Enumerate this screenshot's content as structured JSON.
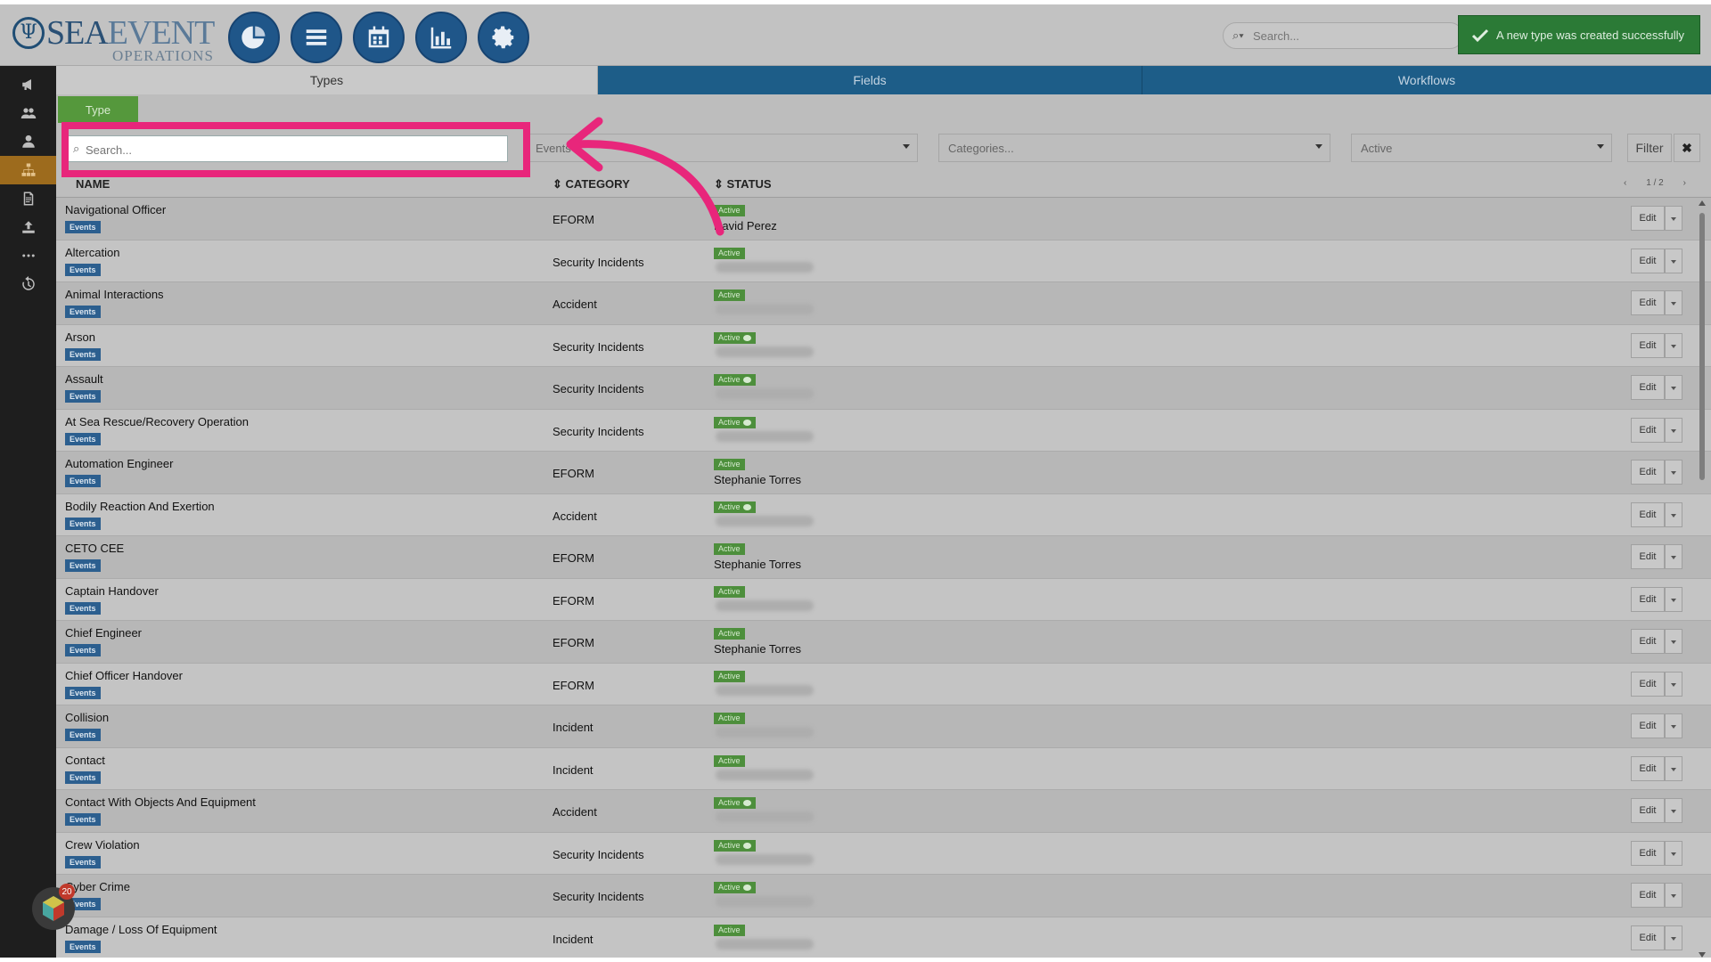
{
  "header": {
    "logo": {
      "brand_a": "SEA",
      "brand_b": "EVENT",
      "subtitle": "OPERATIONS"
    },
    "nav_icons": [
      "dashboard-icon",
      "list-icon",
      "calendar-icon",
      "bar-chart-icon",
      "gear-icon"
    ],
    "search_placeholder": "Search...",
    "toast": "A new type was created successfully"
  },
  "sidebar": {
    "items": [
      "megaphone-icon",
      "users-icon",
      "user-icon",
      "sitemap-icon",
      "document-icon",
      "upload-icon",
      "more-icon",
      "history-icon"
    ],
    "active_index": 3
  },
  "tabs": [
    "Types",
    "Fields",
    "Workflows"
  ],
  "subtab": "Type",
  "filters": {
    "search_placeholder": "Search...",
    "module_value": "Events",
    "categories_placeholder": "Categories...",
    "status_value": "Active",
    "filter_label": "Filter",
    "clear_label": "✖"
  },
  "table": {
    "columns": [
      "NAME",
      "CATEGORY",
      "STATUS"
    ],
    "pager": {
      "prev": "‹",
      "page": "1 / 2",
      "next": "›"
    },
    "badge_label": "Events",
    "status_label": "Active",
    "edit_label": "Edit",
    "rows": [
      {
        "name": "Navigational Officer",
        "category": "EFORM",
        "owner": "David Perez",
        "bubble": false
      },
      {
        "name": "Altercation",
        "category": "Security Incidents",
        "owner": "",
        "bubble": false
      },
      {
        "name": "Animal Interactions",
        "category": "Accident",
        "owner": "",
        "bubble": false
      },
      {
        "name": "Arson",
        "category": "Security Incidents",
        "owner": "",
        "bubble": true
      },
      {
        "name": "Assault",
        "category": "Security Incidents",
        "owner": "",
        "bubble": true
      },
      {
        "name": "At Sea Rescue/Recovery Operation",
        "category": "Security Incidents",
        "owner": "",
        "bubble": true
      },
      {
        "name": "Automation Engineer",
        "category": "EFORM",
        "owner": "Stephanie Torres",
        "bubble": false
      },
      {
        "name": "Bodily Reaction And Exertion",
        "category": "Accident",
        "owner": "",
        "bubble": true
      },
      {
        "name": "CETO CEE",
        "category": "EFORM",
        "owner": "Stephanie Torres",
        "bubble": false
      },
      {
        "name": "Captain Handover",
        "category": "EFORM",
        "owner": "",
        "bubble": false
      },
      {
        "name": "Chief Engineer",
        "category": "EFORM",
        "owner": "Stephanie Torres",
        "bubble": false
      },
      {
        "name": "Chief Officer Handover",
        "category": "EFORM",
        "owner": "",
        "bubble": false
      },
      {
        "name": "Collision",
        "category": "Incident",
        "owner": "",
        "bubble": false
      },
      {
        "name": "Contact",
        "category": "Incident",
        "owner": "",
        "bubble": false
      },
      {
        "name": "Contact With Objects And Equipment",
        "category": "Accident",
        "owner": "",
        "bubble": true
      },
      {
        "name": "Crew Violation",
        "category": "Security Incidents",
        "owner": "",
        "bubble": true
      },
      {
        "name": "Cyber Crime",
        "category": "Security Incidents",
        "owner": "",
        "bubble": true
      },
      {
        "name": "Damage / Loss Of Equipment",
        "category": "Incident",
        "owner": "",
        "bubble": false
      }
    ]
  },
  "widget": {
    "count": "20"
  },
  "colors": {
    "highlight": "#e8267b",
    "brand_blue": "#1f5689",
    "active_green": "#4d8f3c"
  }
}
